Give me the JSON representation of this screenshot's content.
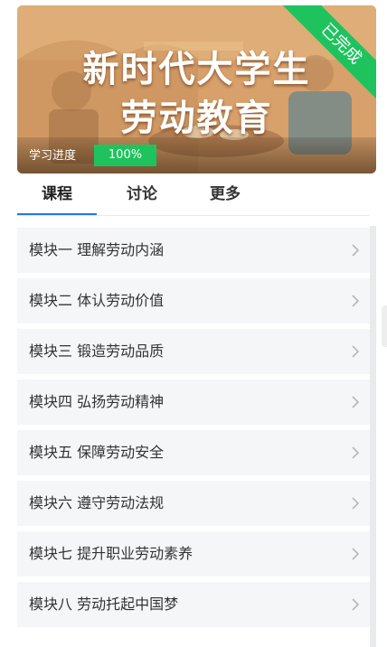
{
  "banner": {
    "title_line1": "新时代大学生",
    "title_line2": "劳动教育",
    "ribbon": "已完成",
    "progress_label": "学习进度",
    "progress_value": "100%",
    "progress_fraction": 1.0
  },
  "tabs": [
    {
      "label": "课程",
      "active": true
    },
    {
      "label": "讨论",
      "active": false
    },
    {
      "label": "更多",
      "active": false
    }
  ],
  "modules": [
    {
      "label": "模块一 理解劳动内涵"
    },
    {
      "label": "模块二 体认劳动价值"
    },
    {
      "label": "模块三 锻造劳动品质"
    },
    {
      "label": "模块四 弘扬劳动精神"
    },
    {
      "label": "模块五 保障劳动安全"
    },
    {
      "label": "模块六 遵守劳动法规"
    },
    {
      "label": "模块七 提升职业劳动素养"
    },
    {
      "label": "模块八 劳动托起中国梦"
    }
  ],
  "colors": {
    "accent_green": "#1fc35e",
    "tab_underline": "#1f7ae0",
    "item_bg": "#f5f6f8"
  }
}
